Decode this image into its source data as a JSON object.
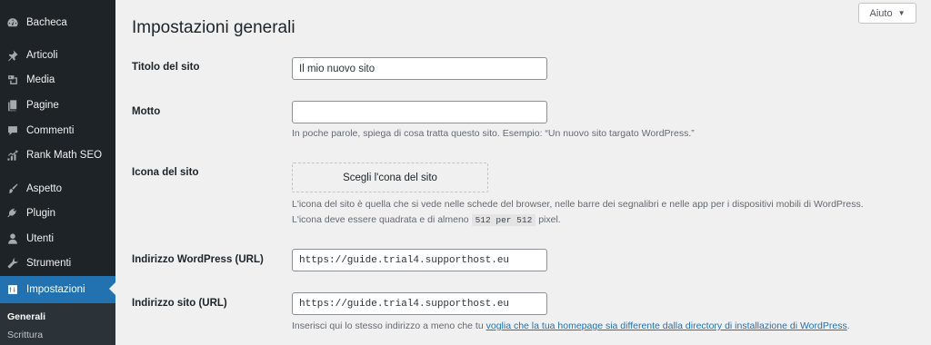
{
  "sidebar": {
    "items": [
      {
        "label": "Bacheca",
        "icon": "dashboard-icon"
      },
      {
        "label": "Articoli",
        "icon": "pin-icon"
      },
      {
        "label": "Media",
        "icon": "media-icon"
      },
      {
        "label": "Pagine",
        "icon": "pages-icon"
      },
      {
        "label": "Commenti",
        "icon": "comment-icon"
      },
      {
        "label": "Rank Math SEO",
        "icon": "rank-math-icon"
      },
      {
        "label": "Aspetto",
        "icon": "brush-icon"
      },
      {
        "label": "Plugin",
        "icon": "plugin-icon"
      },
      {
        "label": "Utenti",
        "icon": "users-icon"
      },
      {
        "label": "Strumenti",
        "icon": "wrench-icon"
      },
      {
        "label": "Impostazioni",
        "icon": "settings-icon"
      }
    ],
    "submenu": [
      "Generali",
      "Scrittura"
    ]
  },
  "help": {
    "label": "Aiuto",
    "caret": "▼"
  },
  "page": {
    "title": "Impostazioni generali"
  },
  "fields": {
    "site_title": {
      "label": "Titolo del sito",
      "value": "Il mio nuovo sito"
    },
    "tagline": {
      "label": "Motto",
      "value": "",
      "description": "In poche parole, spiega di cosa tratta questo sito. Esempio: “Un nuovo sito targato WordPress.”"
    },
    "site_icon": {
      "label": "Icona del sito",
      "button": "Scegli l'cona del sito",
      "description_line1": "L'icona del sito è quella che si vede nelle schede del browser, nelle barre dei segnalibri e nelle app per i dispositivi mobili di WordPress.",
      "description_line2_a": "L'icona deve essere quadrata e di almeno ",
      "description_line2_code": "512 per 512",
      "description_line2_b": " pixel."
    },
    "wp_url": {
      "label": "Indirizzo WordPress (URL)",
      "value": "https://guide.trial4.supporthost.eu"
    },
    "site_url": {
      "label": "Indirizzo sito (URL)",
      "value": "https://guide.trial4.supporthost.eu",
      "description_prefix": "Inserisci qui lo stesso indirizzo a meno che tu ",
      "description_link": "voglia che la tua homepage sia differente dalla directory di installazione di WordPress",
      "description_suffix": "."
    }
  },
  "colors": {
    "sidebar_bg": "#1d2327",
    "accent": "#2271b1",
    "page_bg": "#f0f0f1"
  }
}
